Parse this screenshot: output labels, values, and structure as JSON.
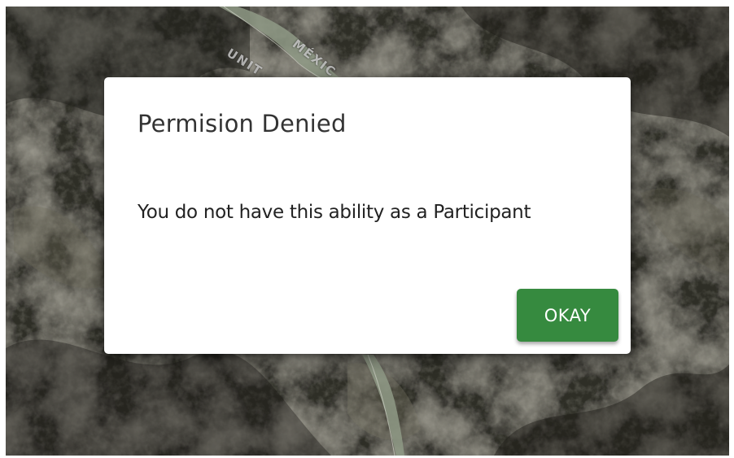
{
  "map": {
    "border_label_us": "UNIT",
    "border_label_mx": "MÉXIC",
    "colors": {
      "terrain": "#3b3a32",
      "river": "#8f9a86"
    }
  },
  "dialog": {
    "title": "Permision Denied",
    "message": "You do not have this ability as a Participant",
    "okay_label": "OKAY",
    "button_color": "#368a3f"
  }
}
